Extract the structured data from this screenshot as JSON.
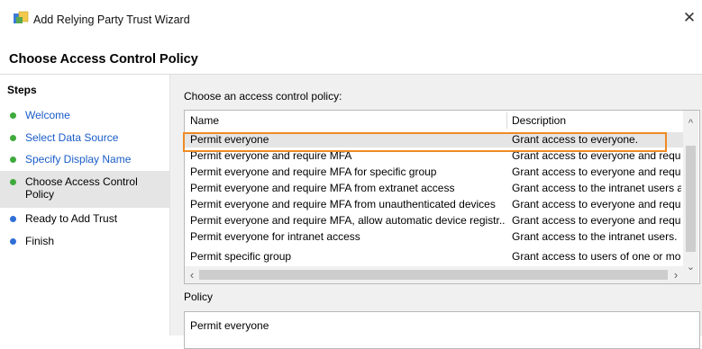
{
  "window": {
    "title": "Add Relying Party Trust Wizard"
  },
  "header": {
    "title": "Choose Access Control Policy"
  },
  "steps": {
    "heading": "Steps",
    "items": [
      {
        "label": "Welcome",
        "status": "complete"
      },
      {
        "label": "Select Data Source",
        "status": "complete"
      },
      {
        "label": "Specify Display Name",
        "status": "complete"
      },
      {
        "label": "Choose Access Control Policy",
        "status": "current"
      },
      {
        "label": "Ready to Add Trust",
        "status": "pending"
      },
      {
        "label": "Finish",
        "status": "pending"
      }
    ]
  },
  "policy_list": {
    "label": "Choose an access control policy:",
    "columns": {
      "name": "Name",
      "description": "Description"
    },
    "rows": [
      {
        "name": "Permit everyone",
        "description": "Grant access to everyone.",
        "selected": true
      },
      {
        "name": "Permit everyone and require MFA",
        "description": "Grant access to everyone and requir"
      },
      {
        "name": "Permit everyone and require MFA for specific group",
        "description": "Grant access to everyone and requir"
      },
      {
        "name": "Permit everyone and require MFA from extranet access",
        "description": "Grant access to the intranet users an"
      },
      {
        "name": "Permit everyone and require MFA from unauthenticated devices",
        "description": "Grant access to everyone and requir"
      },
      {
        "name": "Permit everyone and require MFA, allow automatic device registr...",
        "description": "Grant access to everyone and requir"
      },
      {
        "name": "Permit everyone for intranet access",
        "description": "Grant access to the intranet users."
      },
      {
        "name": "Permit specific group",
        "description": "Grant access to users of one or more"
      }
    ]
  },
  "policy": {
    "label": "Policy",
    "value": "Permit everyone"
  },
  "colors": {
    "highlight": "#ee8a24",
    "complete_dot": "#3faa3c",
    "pending_dot": "#2f6fd6",
    "link": "#1a5dc8"
  },
  "icons": {
    "app": "relying-party-trust-icon",
    "close": "close-icon"
  }
}
